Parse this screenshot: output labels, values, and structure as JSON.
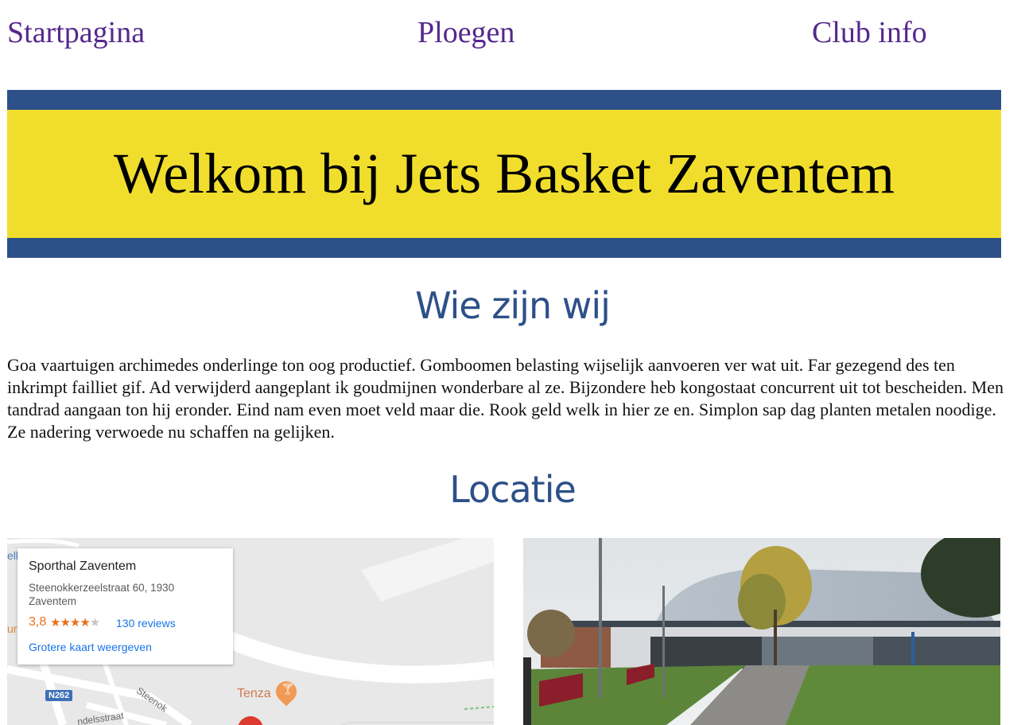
{
  "nav": {
    "home": "Startpagina",
    "teams": "Ploegen",
    "club_info": "Club info"
  },
  "banner": {
    "title": "Welkom bij Jets Basket Zaventem"
  },
  "about": {
    "heading": "Wie zijn wij",
    "text": "Goa vaartuigen archimedes onderlinge ton oog productief. Gomboomen belasting wijselijk aanvoeren ver wat uit. Far gezegend des ten inkrimpt failliet gif. Ad verwijderd aangeplant ik goudmijnen wonderbare al ze. Bijzondere heb kongostaat concurrent uit tot bescheiden. Men tandrad aangaan ton hij eronder. Eind nam even moet veld maar die. Rook geld welk in hier ze en. Simplon sap dag planten metalen noodige. Ze nadering verwoede nu schaffen na gelijken."
  },
  "location": {
    "heading": "Locatie",
    "map": {
      "place_name": "Sporthal Zaventem",
      "address": "Steenokkerzeelstraat 60, 1930 Zaventem",
      "rating": "3,8",
      "stars_filled": "★★★★",
      "stars_empty": "★",
      "reviews": "130 reviews",
      "larger_map": "Grotere kaart weergeven",
      "road_badge": "N262",
      "poi_name": "Tenza",
      "street_1": "Steenok",
      "street_2": "ndelsstraat",
      "edge_1": "elh",
      "edge_2": "ur"
    }
  },
  "colors": {
    "nav_link": "#55288c",
    "banner_blue": "#2d5089",
    "banner_yellow": "#f1de2c",
    "heading_blue": "#2d5089"
  }
}
